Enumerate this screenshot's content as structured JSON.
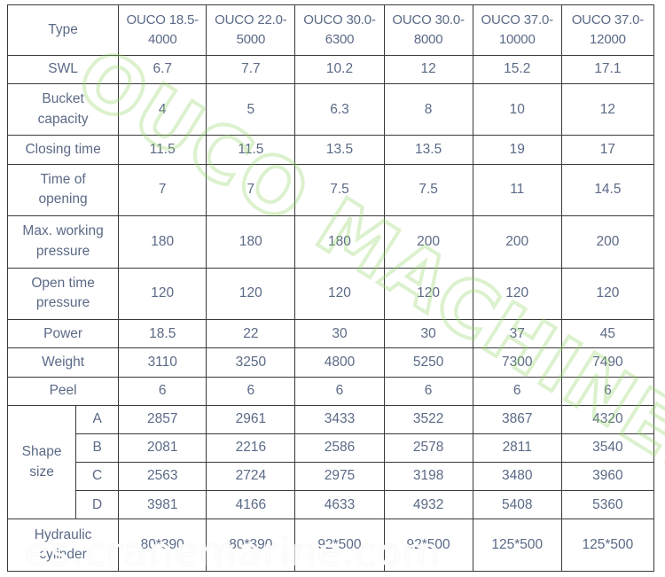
{
  "document": {
    "kind": "product-specification-table",
    "watermark_diagonal": "OUCO MACHINERY",
    "watermark_bottom": "es.cranemarine.com",
    "watermark_color": "#8CD25A"
  },
  "table": {
    "row_label_header": "Type",
    "models": [
      "OUCO 18.5-4000",
      "OUCO 22.0-5000",
      "OUCO 30.0-6300",
      "OUCO 30.0-8000",
      "OUCO 37.0-10000",
      "OUCO 37.0-12000"
    ],
    "models_split": [
      {
        "line1": "OUCO 18.5-",
        "line2": "4000"
      },
      {
        "line1": "OUCO 22.0-",
        "line2": "5000"
      },
      {
        "line1": "OUCO 30.0-",
        "line2": "6300"
      },
      {
        "line1": "OUCO 30.0-",
        "line2": "8000"
      },
      {
        "line1": "OUCO 37.0-",
        "line2": "10000"
      },
      {
        "line1": "OUCO 37.0-",
        "line2": "12000"
      }
    ],
    "rows": [
      {
        "label": "SWL",
        "label_line1": "SWL",
        "label_line2": "",
        "values": [
          "6.7",
          "7.7",
          "10.2",
          "12",
          "15.2",
          "17.1"
        ]
      },
      {
        "label": "Bucket capacity",
        "label_line1": "Bucket",
        "label_line2": "capacity",
        "values": [
          "4",
          "5",
          "6.3",
          "8",
          "10",
          "12"
        ]
      },
      {
        "label": "Closing time",
        "label_line1": "Closing time",
        "label_line2": "",
        "values": [
          "11.5",
          "11.5",
          "13.5",
          "13.5",
          "19",
          "17"
        ]
      },
      {
        "label": "Time of opening",
        "label_line1": "Time of",
        "label_line2": "opening",
        "values": [
          "7",
          "7",
          "7.5",
          "7.5",
          "11",
          "14.5"
        ]
      },
      {
        "label": "Max. working pressure",
        "label_line1": "Max. working",
        "label_line2": "pressure",
        "values": [
          "180",
          "180",
          "180",
          "200",
          "200",
          "200"
        ]
      },
      {
        "label": "Open time pressure",
        "label_line1": "Open time",
        "label_line2": "pressure",
        "values": [
          "120",
          "120",
          "120",
          "120",
          "120",
          "120"
        ]
      },
      {
        "label": "Power",
        "label_line1": "Power",
        "label_line2": "",
        "values": [
          "18.5",
          "22",
          "30",
          "30",
          "37",
          "45"
        ]
      },
      {
        "label": "Weight",
        "label_line1": "Weight",
        "label_line2": "",
        "values": [
          "3110",
          "3250",
          "4800",
          "5250",
          "7300",
          "7490"
        ]
      },
      {
        "label": "Peel",
        "label_line1": "Peel",
        "label_line2": "",
        "values": [
          "6",
          "6",
          "6",
          "6",
          "6",
          "6"
        ]
      }
    ],
    "shape_size": {
      "label_line1": "Shape",
      "label_line2": "size",
      "sub_rows": [
        {
          "key": "A",
          "values": [
            "2857",
            "2961",
            "3433",
            "3522",
            "3867",
            "4320"
          ]
        },
        {
          "key": "B",
          "values": [
            "2081",
            "2216",
            "2586",
            "2578",
            "2811",
            "3540"
          ]
        },
        {
          "key": "C",
          "values": [
            "2563",
            "2724",
            "2975",
            "3198",
            "3480",
            "3960"
          ]
        },
        {
          "key": "D",
          "values": [
            "3981",
            "4166",
            "4633",
            "4932",
            "5408",
            "5360"
          ]
        }
      ]
    },
    "hydraulic_cylinder": {
      "label_line1": "Hydraulic",
      "label_line2": "cylinder",
      "values": [
        "80*390",
        "80*390",
        "92*500",
        "92*500",
        "125*500",
        "125*500"
      ]
    }
  }
}
